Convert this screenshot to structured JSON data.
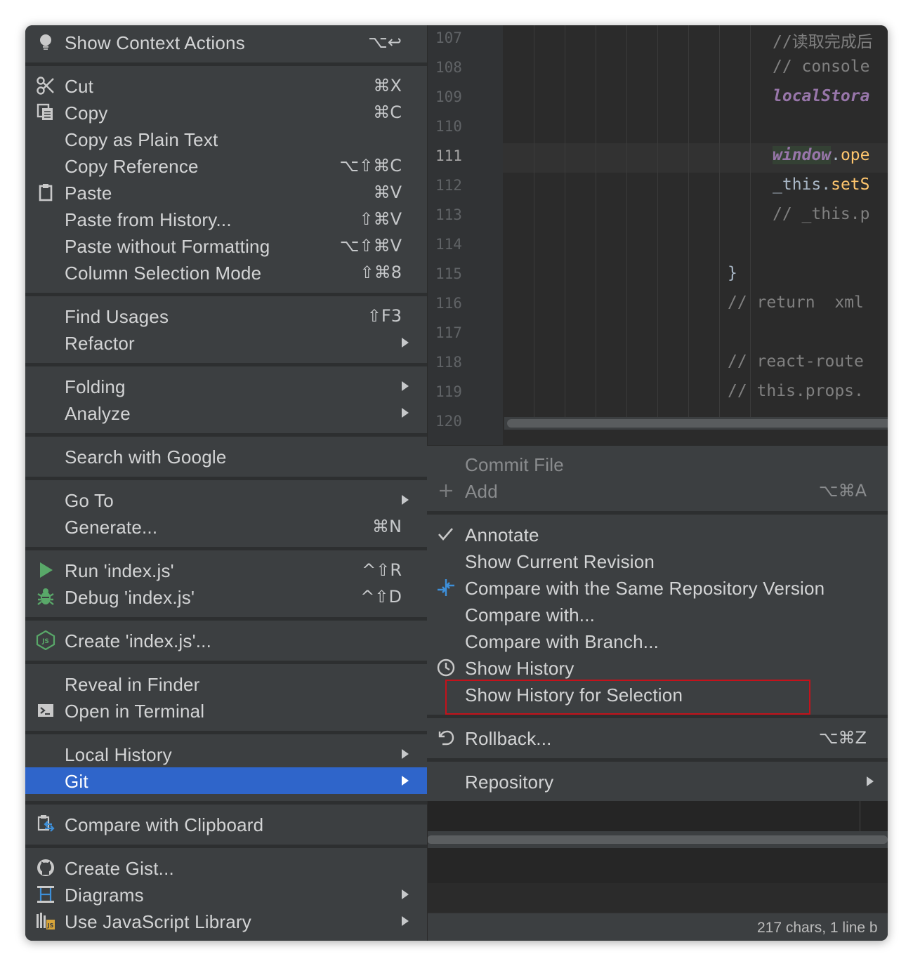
{
  "editor": {
    "line_numbers": [
      "107",
      "108",
      "109",
      "110",
      "111",
      "112",
      "113",
      "114",
      "115",
      "116",
      "117",
      "118",
      "119",
      "120"
    ],
    "current_line": "111",
    "code": {
      "l107": "//读取完成后",
      "l108": "// console",
      "l109": "localStora",
      "l111_window": "window",
      "l111_dot": ".",
      "l111_method": "ope",
      "l112_this": "_this.",
      "l112_method": "setS",
      "l113": "// _this.p",
      "l115": "}",
      "l116": "// return  xml",
      "l118": "// react-route",
      "l119": "// this.props."
    }
  },
  "status_bar": {
    "text": "217 chars, 1 line b"
  },
  "context_menu": {
    "show_context_actions": {
      "label": "Show Context Actions",
      "shortcut": "⌥↩",
      "icon": "lightbulb-icon"
    },
    "cut": {
      "label": "Cut",
      "shortcut": "⌘X",
      "icon": "scissors-icon"
    },
    "copy": {
      "label": "Copy",
      "shortcut": "⌘C",
      "icon": "copy-icon"
    },
    "copy_plain": {
      "label": "Copy as Plain Text"
    },
    "copy_reference": {
      "label": "Copy Reference",
      "shortcut": "⌥⇧⌘C"
    },
    "paste": {
      "label": "Paste",
      "shortcut": "⌘V",
      "icon": "clipboard-icon"
    },
    "paste_history": {
      "label": "Paste from History...",
      "shortcut": "⇧⌘V"
    },
    "paste_no_format": {
      "label": "Paste without Formatting",
      "shortcut": "⌥⇧⌘V"
    },
    "column_selection": {
      "label": "Column Selection Mode",
      "shortcut": "⇧⌘8"
    },
    "find_usages": {
      "label": "Find Usages",
      "shortcut": "⇧F3"
    },
    "refactor": {
      "label": "Refactor"
    },
    "folding": {
      "label": "Folding"
    },
    "analyze": {
      "label": "Analyze"
    },
    "search_google": {
      "label": "Search with Google"
    },
    "go_to": {
      "label": "Go To"
    },
    "generate": {
      "label": "Generate...",
      "shortcut": "⌘N"
    },
    "run": {
      "label": "Run 'index.js'",
      "shortcut": "^⇧R",
      "icon": "run-icon"
    },
    "debug": {
      "label": "Debug 'index.js'",
      "shortcut": "^⇧D",
      "icon": "debug-icon"
    },
    "create": {
      "label": "Create 'index.js'...",
      "icon": "nodejs-icon"
    },
    "reveal_finder": {
      "label": "Reveal in Finder"
    },
    "open_terminal": {
      "label": "Open in Terminal",
      "icon": "terminal-icon"
    },
    "local_history": {
      "label": "Local History"
    },
    "git": {
      "label": "Git"
    },
    "compare_clipboard": {
      "label": "Compare with Clipboard",
      "icon": "compare-clipboard-icon"
    },
    "create_gist": {
      "label": "Create Gist...",
      "icon": "github-icon"
    },
    "diagrams": {
      "label": "Diagrams",
      "icon": "diagram-icon"
    },
    "js_library": {
      "label": "Use JavaScript Library",
      "icon": "library-icon"
    }
  },
  "git_menu": {
    "commit_file": {
      "label": "Commit File"
    },
    "add": {
      "label": "Add",
      "shortcut": "⌥⌘A",
      "icon": "plus-icon"
    },
    "annotate": {
      "label": "Annotate",
      "icon": "check-icon"
    },
    "show_current_revision": {
      "label": "Show Current Revision"
    },
    "compare_same_repo": {
      "label": "Compare with the Same Repository Version",
      "icon": "compare-arrows-icon"
    },
    "compare_with": {
      "label": "Compare with..."
    },
    "compare_branch": {
      "label": "Compare with Branch..."
    },
    "show_history": {
      "label": "Show History",
      "icon": "clock-icon"
    },
    "show_history_selection": {
      "label": "Show History for Selection"
    },
    "rollback": {
      "label": "Rollback...",
      "shortcut": "⌥⌘Z",
      "icon": "undo-icon"
    },
    "repository": {
      "label": "Repository"
    }
  },
  "colors": {
    "menu_bg": "#3c3f41",
    "selection": "#2f65ca",
    "highlight_box": "#c4121b",
    "run_green": "#59a869",
    "compare_blue": "#3d8fd9"
  }
}
